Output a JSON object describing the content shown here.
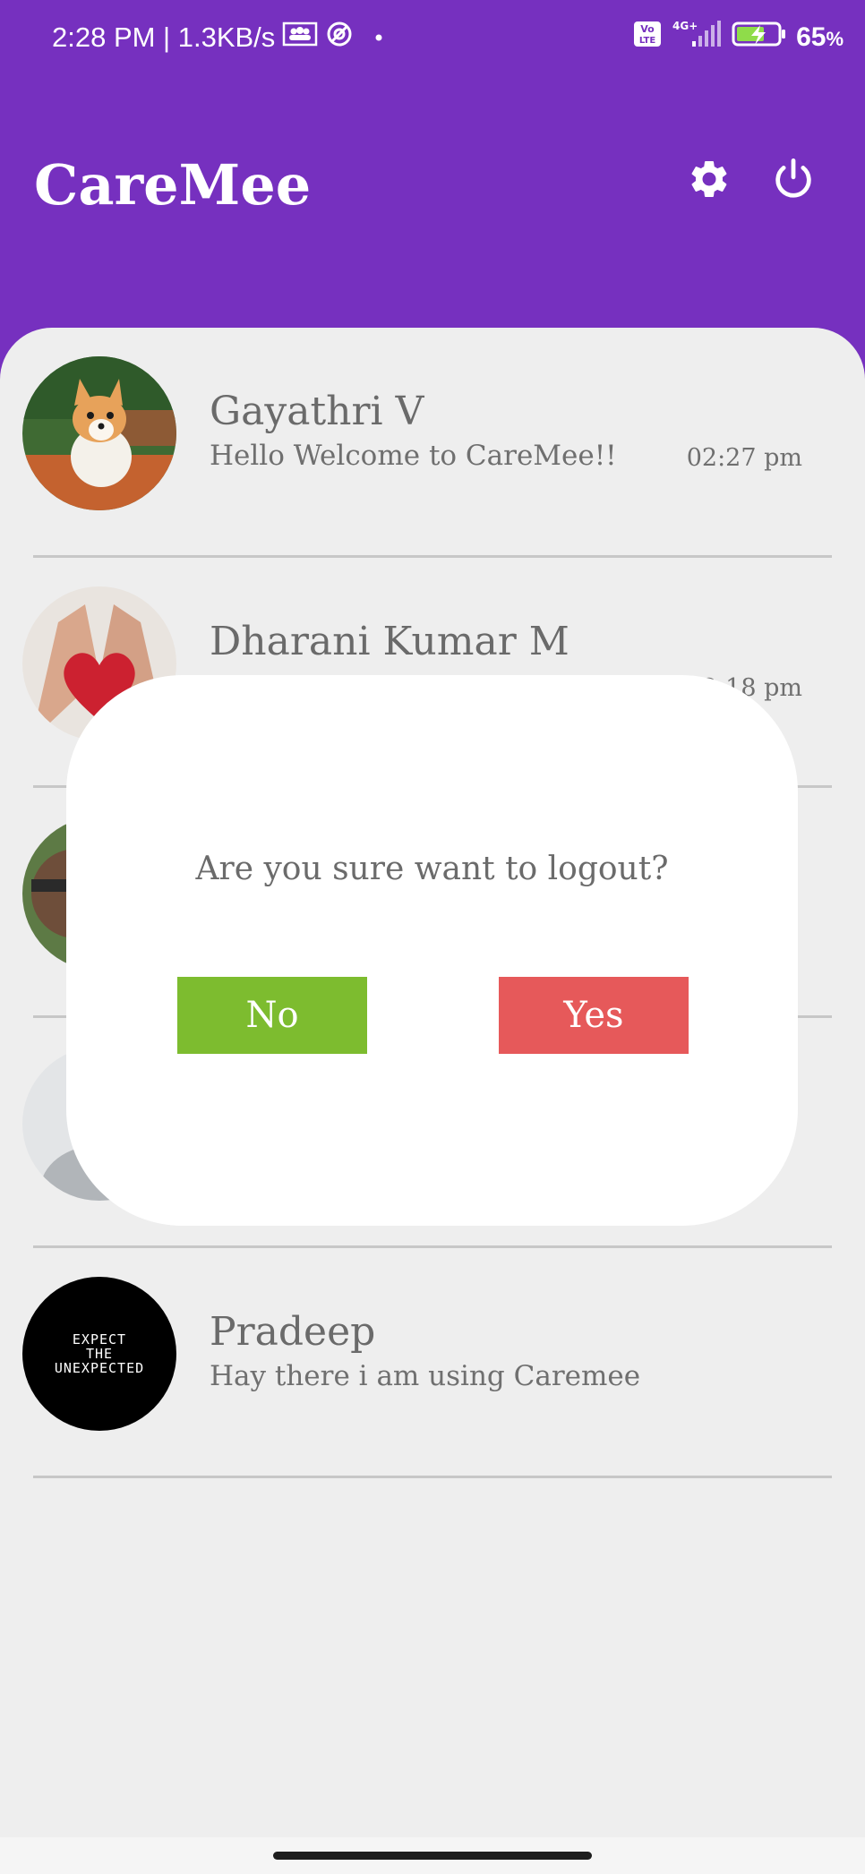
{
  "status_bar": {
    "time_speed": "2:28 PM | 1.3KB/s",
    "network": "4G+",
    "volte": "Vo LTE",
    "battery": "65",
    "battery_unit": "%"
  },
  "app": {
    "title": "CareMee"
  },
  "chats": [
    {
      "name": "Gayathri V",
      "message": "Hello Welcome to CareMee!!",
      "time": "02:27 pm"
    },
    {
      "name": "Dharani Kumar M",
      "message": "",
      "time": "2:18 pm"
    },
    {
      "name": "",
      "message": "",
      "time": ""
    },
    {
      "name": "",
      "message": "",
      "time": ""
    },
    {
      "name": "Pradeep",
      "message": "Hay there i am using Caremee",
      "time": "",
      "avatar_text": [
        "EXPECT",
        "THE",
        "UNEXPECTED"
      ]
    }
  ],
  "dialog": {
    "message": "Are you sure want to logout?",
    "no_label": "No",
    "yes_label": "Yes"
  },
  "colors": {
    "primary": "#7630bf",
    "no_button": "#7dbc2f",
    "yes_button": "#e6595a"
  }
}
